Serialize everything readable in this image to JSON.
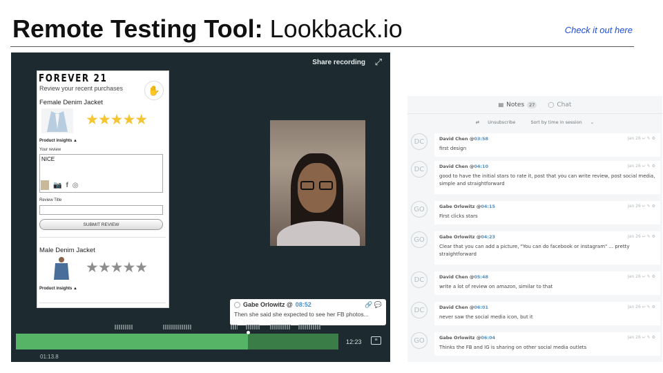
{
  "slide": {
    "title_bold": "Remote Testing Tool:",
    "title_rest": " Lookback.io",
    "link": "Check it out here"
  },
  "player": {
    "share_label": "Share recording",
    "expand_icon": "expand-icon",
    "duration": "12:23",
    "current_time": "01:13.8",
    "progress_fraction": 0.72
  },
  "app": {
    "brand": "FOREVER 21",
    "subtitle": "Review your recent purchases",
    "product1": "Female Denim Jacket",
    "product1_rating": 5,
    "insights_label": "Product insights",
    "your_review_label": "Your review",
    "review_text": "NICE",
    "review_title_label": "Review Title",
    "submit_label": "SUBMIT REVIEW",
    "product2": "Male Denim Jacket",
    "product2_rating": 0,
    "stars_filled": "★★★★★",
    "stars_empty": "★★★★★"
  },
  "popup": {
    "author": "Gabe Orlowitz @",
    "timestamp": "08:52",
    "text": "Then she said she expected to see her FB photos..."
  },
  "notes_panel": {
    "tabs": [
      {
        "label": "Notes",
        "count": "27",
        "icon": "notes-icon"
      },
      {
        "label": "Chat",
        "icon": "chat-bubble-icon"
      }
    ],
    "unsubscribe": "Unsubscribe",
    "sort": "Sort by time in session",
    "notes": [
      {
        "initials": "DC",
        "author": "David Chen @",
        "time": "03:58",
        "date": "Jan 26",
        "body": "first design"
      },
      {
        "initials": "DC",
        "author": "David Chen @",
        "time": "04:10",
        "date": "Jan 26",
        "body": "good to have the initial stars to rate it, post that you can write review, post social media, simple and straightforward"
      },
      {
        "initials": "GO",
        "author": "Gabe Orlowitz @",
        "time": "04:15",
        "date": "Jan 26",
        "body": "First clicks stars"
      },
      {
        "initials": "GO",
        "author": "Gabe Orlowitz @",
        "time": "04:23",
        "date": "Jan 26",
        "body": "Clear that you can add a picture, \"You can do facebook or instagram\" ... pretty straightforward"
      },
      {
        "initials": "DC",
        "author": "David Chen @",
        "time": "05:48",
        "date": "Jan 26",
        "body": "write a lot of review on amazon, similar to that"
      },
      {
        "initials": "DC",
        "author": "David Chen @",
        "time": "06:01",
        "date": "Jan 26",
        "body": "never saw the social media icon, but it"
      },
      {
        "initials": "GO",
        "author": "Gabe Orlowitz @",
        "time": "06:04",
        "date": "Jan 26",
        "body": "Thinks the FB and IG is sharing on other social media outlets"
      }
    ]
  }
}
